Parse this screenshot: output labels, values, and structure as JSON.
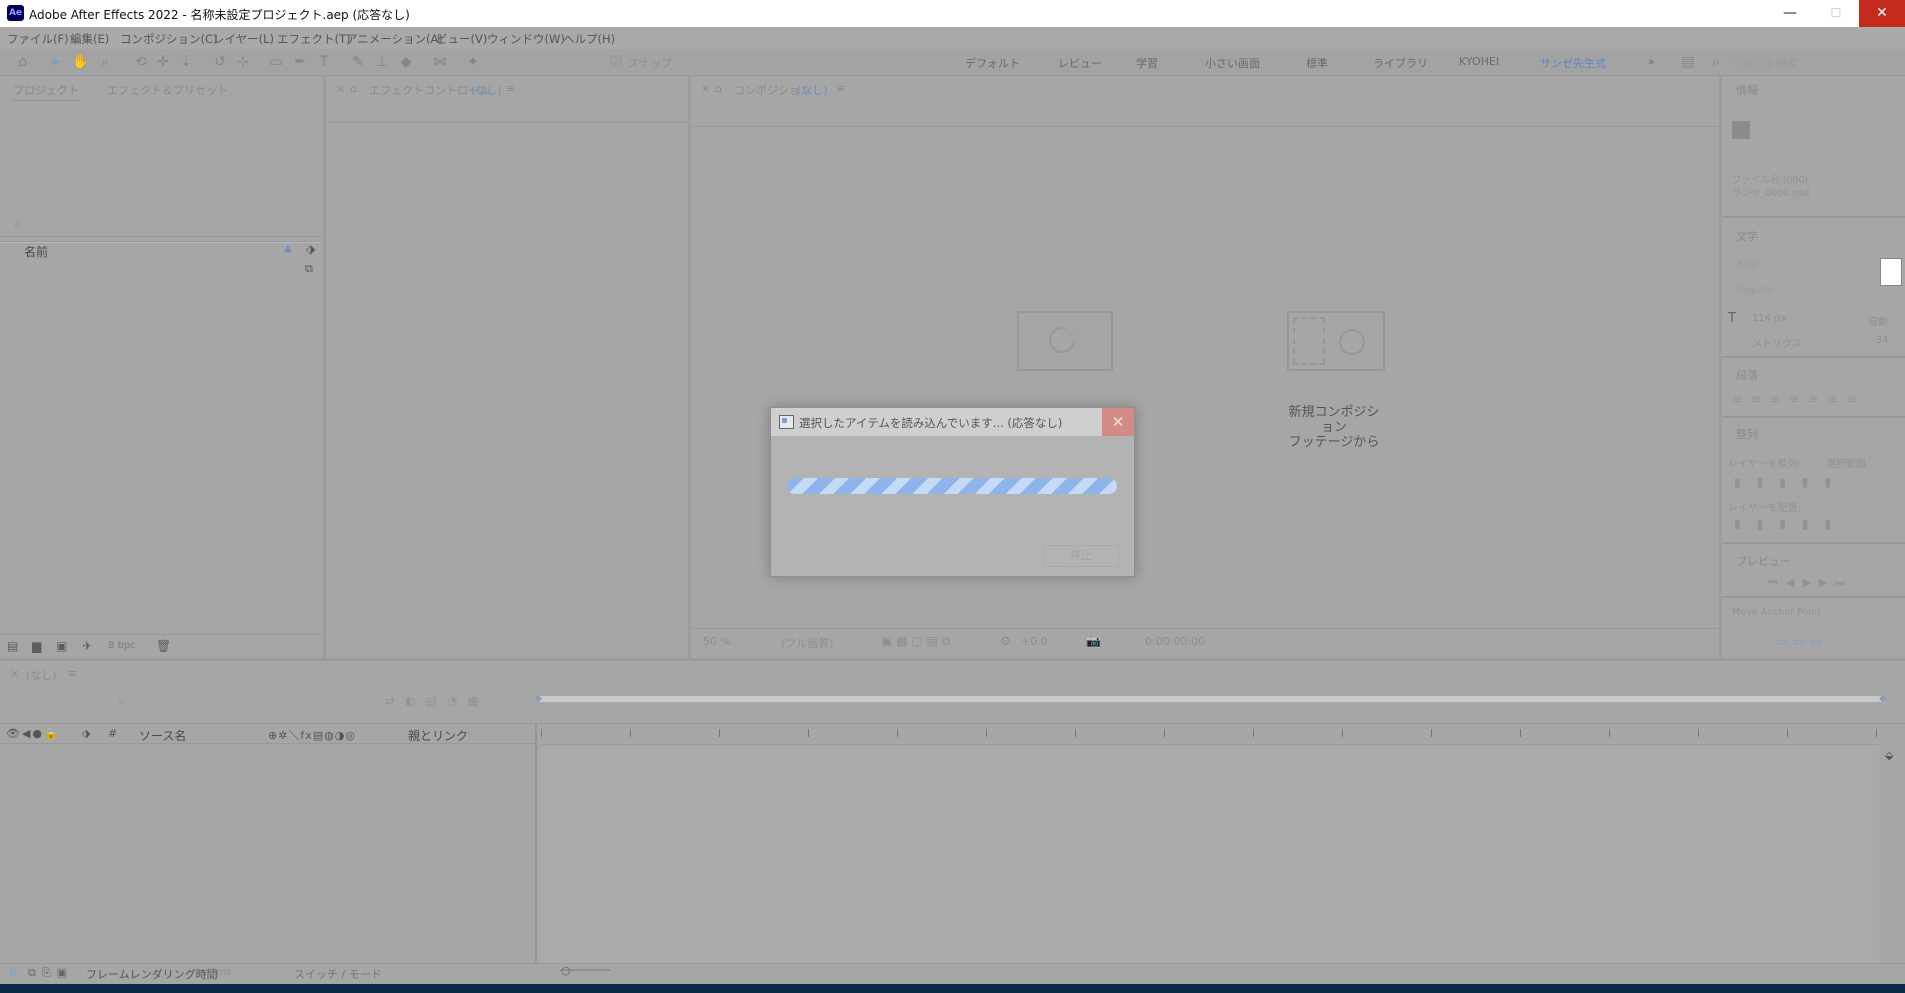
{
  "window": {
    "title": "Adobe After Effects 2022 - 名称未設定プロジェクト.aep (応答なし)",
    "app_icon": "Ae",
    "minimize": "—",
    "maximize": "☐",
    "close": "✕"
  },
  "menu": [
    "ファイル(F)",
    "編集(E)",
    "コンポジション(C)",
    "レイヤー(L)",
    "エフェクト(T)",
    "アニメーション(A)",
    "ビュー(V)",
    "ウィンドウ(W)",
    "ヘルプ(H)"
  ],
  "toolbar": {
    "snap_label": "スナップ",
    "workspaces": [
      "デフォルト",
      "レビュー",
      "学習",
      "小さい画面",
      "標準",
      "ライブラリ",
      "KYOHEI",
      "サンゼ先生式"
    ],
    "active_workspace": "サンゼ先生式",
    "more": "»",
    "search_placeholder": "ヘルプを検索"
  },
  "project_panel": {
    "tabs": [
      "プロジェクト",
      "エフェクト＆プリセット"
    ],
    "column_name": "名前",
    "bpc": "8 bpc"
  },
  "effect_controls": {
    "tab_prefix": "エフェクトコントロール",
    "tab_value": "(なし)"
  },
  "composition": {
    "tab_prefix": "コンポジション",
    "tab_value": "(なし)",
    "new_from_footage_line1": "新規コンポジション",
    "new_from_footage_line2": "フッテージから",
    "zoom": "50 %",
    "resolution": "(フル画質)",
    "exposure": "+0.0",
    "timecode": "0:00:00:00"
  },
  "right_panels": {
    "info": "情報",
    "info_file_label": "ファイル名:(000)",
    "info_file_name": "サンゼ_0000.psd",
    "text": "文字",
    "font_name": "Arial",
    "font_style": "Regular",
    "font_size": "114 px",
    "leading": "自動",
    "kerning": "メトリクス",
    "tracking": "-34",
    "paragraph": "段落",
    "align": "整列",
    "align_to": "レイヤーを整列:",
    "align_target": "選択範囲",
    "distribute": "レイヤーを配置:",
    "preview": "プレビュー",
    "move_anchor": "Move Anchor Point"
  },
  "timeline": {
    "tab_label": "(なし)",
    "col_source": "ソース名",
    "col_parent": "親とリンク",
    "frame_render_label": "フレームレンダリング時間",
    "frame_render_value": "0ms",
    "switch_mode": "スイッチ / モード"
  },
  "dialog": {
    "title": "選択したアイテムを読み込んでいます... (応答なし)",
    "progress": 1.0,
    "stop_button": "停止"
  },
  "colors": {
    "accent_blue": "#5c86c9",
    "close_red": "#c42b1c",
    "progress_stripe_a": "#8fb4ea",
    "progress_stripe_b": "#c4daf7"
  }
}
